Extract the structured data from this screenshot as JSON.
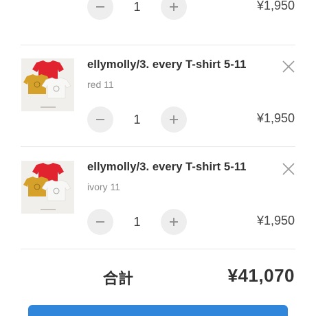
{
  "cart": {
    "items": [
      {
        "name": "",
        "variant": "",
        "quantity": "1",
        "price": "¥1,950",
        "minus_icon": "minus-icon",
        "plus_icon": "plus-icon"
      },
      {
        "name": "ellymolly/3. every T-shirt 5-11",
        "variant": "red 11",
        "quantity": "1",
        "price": "¥1,950",
        "remove_icon": "close-icon",
        "minus_icon": "minus-icon",
        "plus_icon": "plus-icon"
      },
      {
        "name": "ellymolly/3. every T-shirt 5-11",
        "variant": "ivory 11",
        "quantity": "1",
        "price": "¥1,950",
        "remove_icon": "close-icon",
        "minus_icon": "minus-icon",
        "plus_icon": "plus-icon"
      }
    ]
  },
  "summary": {
    "total_label": "合計",
    "total_value": "¥41,070"
  },
  "colors": {
    "accent": "#2f86db",
    "button_bg": "#eeeeee",
    "divider": "#e6e6e6"
  }
}
